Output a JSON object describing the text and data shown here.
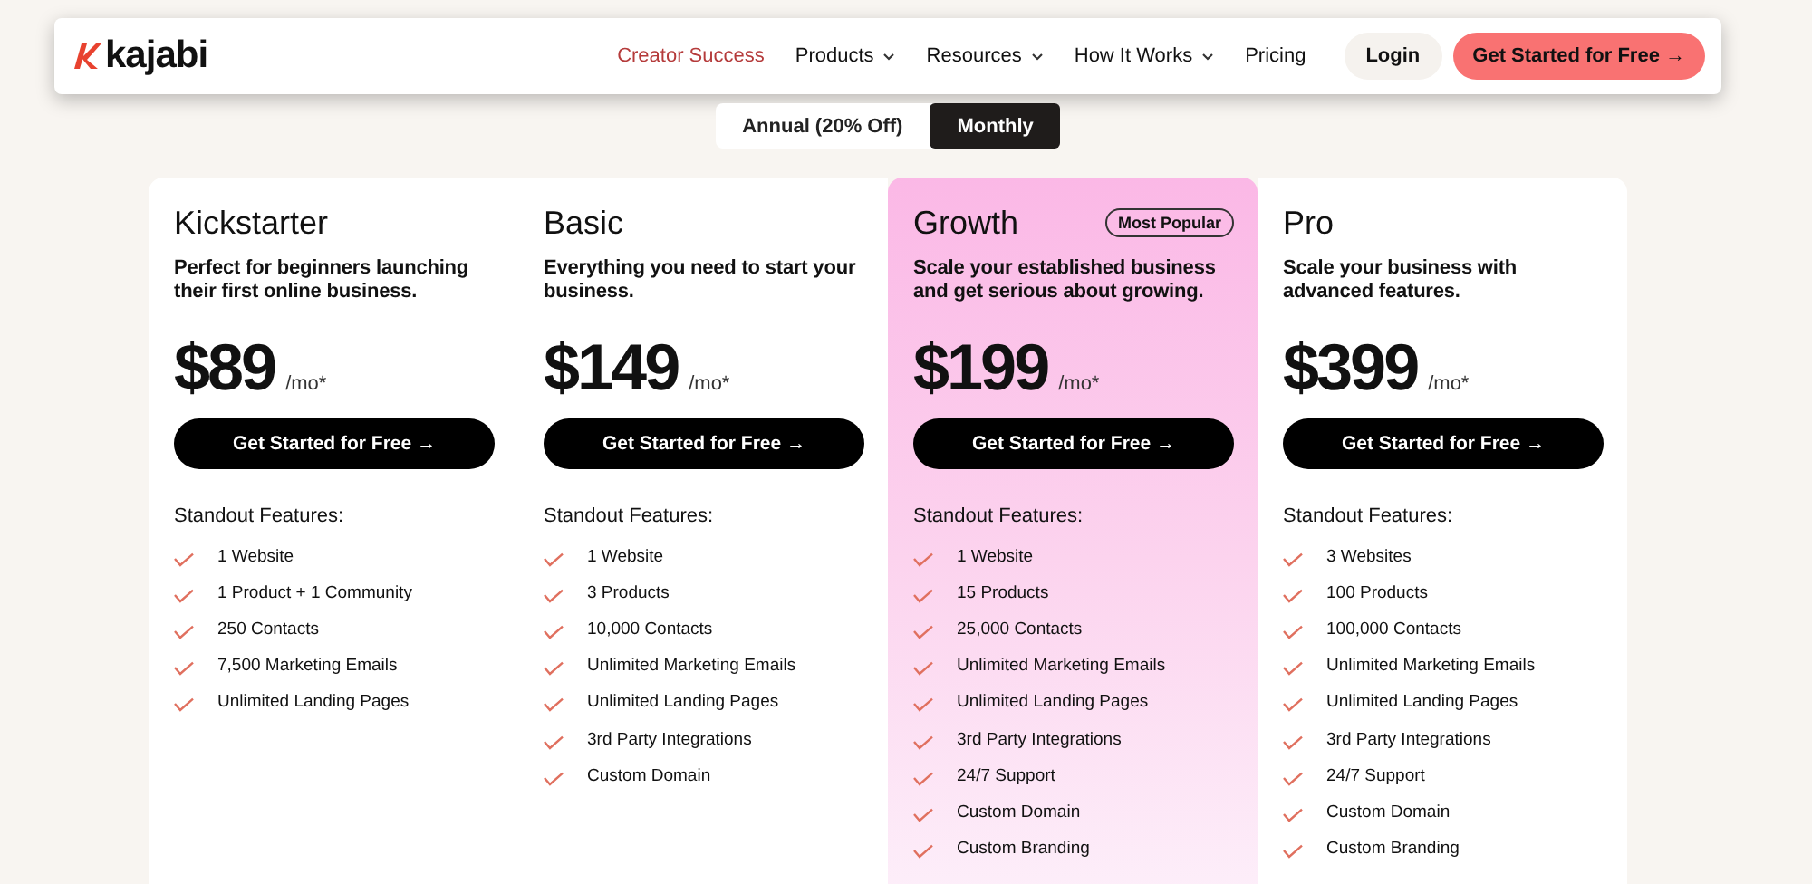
{
  "header": {
    "logo": "kajabi",
    "nav": [
      {
        "label": "Creator Success",
        "highlighted": true,
        "dropdown": false
      },
      {
        "label": "Products",
        "highlighted": false,
        "dropdown": true
      },
      {
        "label": "Resources",
        "highlighted": false,
        "dropdown": true
      },
      {
        "label": "How It Works",
        "highlighted": false,
        "dropdown": true
      },
      {
        "label": "Pricing",
        "highlighted": false,
        "dropdown": false
      }
    ],
    "login": "Login",
    "cta": "Get Started for Free →"
  },
  "billing": [
    {
      "label": "Annual (20% Off)",
      "selected": false
    },
    {
      "label": "Monthly",
      "selected": true
    }
  ],
  "plans": [
    {
      "name": "Kickstarter",
      "featured": false,
      "description": "Perfect for beginners launching their first online business.",
      "price": "$89",
      "period": "/mo*",
      "button": "Get Started for Free →",
      "features_title": "Standout Features:",
      "features": [
        "1 Website",
        "1 Product + 1 Community",
        "250 Contacts",
        "7,500 Marketing Emails",
        "Unlimited Landing Pages"
      ]
    },
    {
      "name": "Basic",
      "featured": false,
      "description": "Everything you need to start your business.",
      "price": "$149",
      "period": "/mo*",
      "button": "Get Started for Free →",
      "features_title": "Standout Features:",
      "features": [
        "1 Website",
        "3 Products",
        "10,000 Contacts",
        "Unlimited Marketing Emails",
        "Unlimited Landing Pages",
        "3rd Party Integrations",
        "Custom Domain"
      ]
    },
    {
      "name": "Growth",
      "featured": true,
      "badge": "Most Popular",
      "description": "Scale your established business and get serious about growing.",
      "price": "$199",
      "period": "/mo*",
      "button": "Get Started for Free →",
      "features_title": "Standout Features:",
      "features": [
        "1 Website",
        "15 Products",
        "25,000 Contacts",
        "Unlimited Marketing Emails",
        "Unlimited Landing Pages",
        "3rd Party Integrations",
        "24/7 Support",
        "Custom Domain",
        "Custom Branding"
      ]
    },
    {
      "name": "Pro",
      "featured": false,
      "description": "Scale your business with advanced features.",
      "price": "$399",
      "period": "/mo*",
      "button": "Get Started for Free →",
      "features_title": "Standout Features:",
      "features": [
        "3 Websites",
        "100 Products",
        "100,000 Contacts",
        "Unlimited Marketing Emails",
        "Unlimited Landing Pages",
        "3rd Party Integrations",
        "24/7 Support",
        "Custom Domain",
        "Custom Branding"
      ]
    }
  ]
}
